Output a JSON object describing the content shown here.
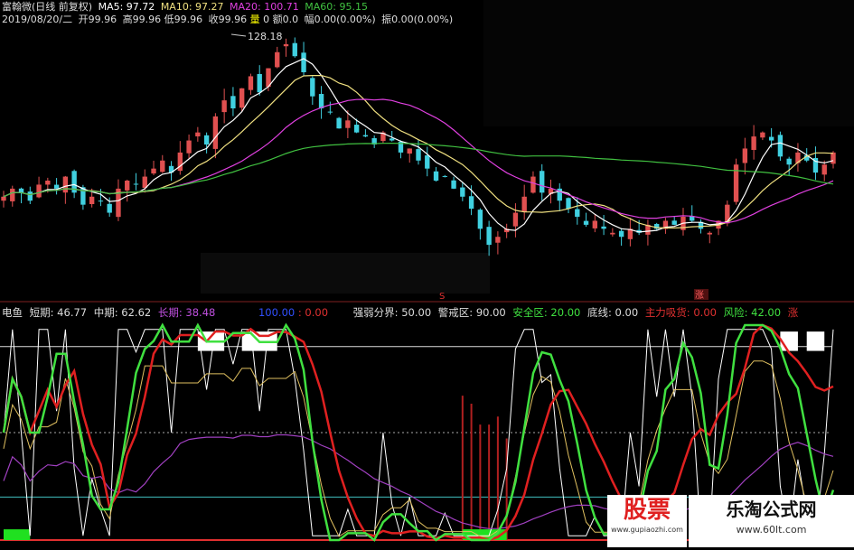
{
  "header": {
    "name": "富翰微(日线 前复权)",
    "ma5": "MA5: 97.72",
    "ma10": "MA10: 97.27",
    "ma20": "MA20: 100.71",
    "ma60": "MA60: 95.15",
    "date": "2019/08/20/二",
    "open": "开99.96",
    "high": "高99.96",
    "low": "低99.96",
    "close": "收99.96",
    "vol_label": "量",
    "vol": "0",
    "amount": "额0.0",
    "change": "幅0.00(0.00%)",
    "amplitude": "振0.00(0.00%)",
    "max_price": "128.18"
  },
  "indicator_bar": {
    "name": "电鱼",
    "short": "短期: 46.77",
    "mid": "中期: 62.62",
    "long": "长期: 38.48",
    "hundred": "100.00",
    "zero": ": 0.00",
    "divide": "强弱分界: 50.00",
    "warn": "警戒区: 90.00",
    "safe": "安全区: 20.00",
    "bottom": "底线: 0.00",
    "main": "主力吸货: 0.00",
    "risk": "风险: 42.00",
    "zhang": "涨"
  },
  "markers": {
    "s_label": "S",
    "zhang": "涨"
  },
  "watermark": {
    "left": "股票",
    "left_url": "www.gupiaozhi.com",
    "right": "乐淘公式网",
    "right_url": "www.60lt.com"
  },
  "colors": {
    "bg": "#000000",
    "up": "#e05050",
    "down": "#40d0e0",
    "ma5": "#ffffff",
    "ma10": "#f0e080",
    "ma20": "#e040e0",
    "ma60": "#40c040",
    "short": "#ffffff",
    "mid": "#40e040",
    "long": "#e02020",
    "long2": "#a040c0",
    "yellow": "#e0c060"
  },
  "chart_data": [
    {
      "type": "candlestick",
      "title": "富翰微(日线 前复权)",
      "series_labels": [
        "MA5",
        "MA10",
        "MA20",
        "MA60"
      ],
      "last": {
        "open": 99.96,
        "high": 99.96,
        "low": 99.96,
        "close": 99.96
      },
      "max_marker": 128.18,
      "price_path": [
        88,
        90,
        89,
        87,
        91,
        92,
        90,
        93,
        89,
        86,
        88,
        87,
        84,
        90,
        92,
        91,
        93,
        95,
        97,
        94,
        99,
        102,
        104,
        101,
        108,
        112,
        110,
        115,
        118,
        114,
        120,
        124,
        126,
        123,
        119,
        113,
        110,
        109,
        105,
        107,
        104,
        103,
        101,
        104,
        102,
        99,
        100,
        97,
        95,
        92,
        93,
        90,
        88,
        85,
        80,
        76,
        78,
        80,
        84,
        88,
        93,
        89,
        90,
        87,
        85,
        83,
        81,
        82,
        80,
        79,
        78,
        80,
        79,
        81,
        80,
        82,
        81,
        83,
        82,
        80,
        79,
        82,
        86,
        96,
        100,
        103,
        104,
        102,
        98,
        96,
        99,
        97,
        94,
        96,
        99
      ]
    },
    {
      "type": "line",
      "title": "电鱼",
      "series": [
        {
          "name": "短期",
          "last": 46.77
        },
        {
          "name": "中期",
          "last": 62.62
        },
        {
          "name": "长期",
          "last": 38.48
        }
      ],
      "levels": {
        "强弱分界": 50.0,
        "警戒区": 90.0,
        "安全区": 20.0,
        "底线": 0.0,
        "风险": 42.0
      },
      "ylim": [
        0,
        100
      ]
    }
  ]
}
